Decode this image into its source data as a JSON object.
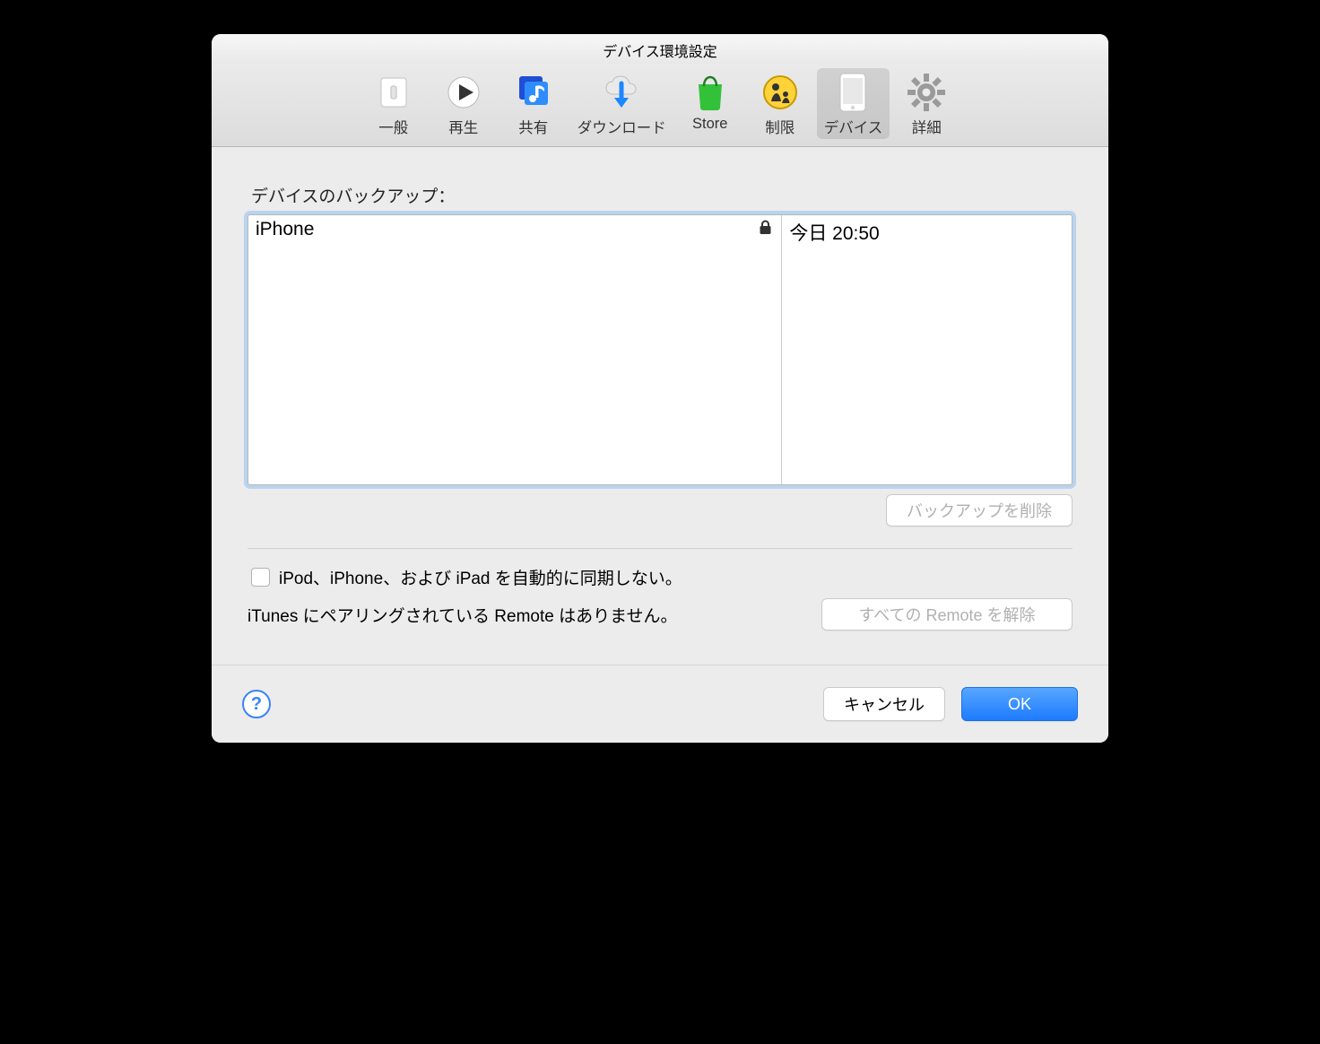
{
  "window": {
    "title": "デバイス環境設定"
  },
  "toolbar": {
    "items": [
      {
        "id": "general",
        "label": "一般"
      },
      {
        "id": "playback",
        "label": "再生"
      },
      {
        "id": "sharing",
        "label": "共有"
      },
      {
        "id": "downloads",
        "label": "ダウンロード"
      },
      {
        "id": "store",
        "label": "Store"
      },
      {
        "id": "parental",
        "label": "制限"
      },
      {
        "id": "devices",
        "label": "デバイス",
        "selected": true
      },
      {
        "id": "advanced",
        "label": "詳細"
      }
    ]
  },
  "backups": {
    "heading": "デバイスのバックアップ：",
    "rows": [
      {
        "name": "iPhone",
        "locked": true,
        "date": "今日 20:50"
      }
    ],
    "delete_label": "バックアップを削除",
    "delete_enabled": false
  },
  "options": {
    "no_autosync_label": "iPod、iPhone、および iPad を自動的に同期しない。",
    "no_autosync_checked": false,
    "pairing_status": "iTunes にペアリングされている Remote はありません。",
    "forget_remotes_label": "すべての Remote を解除",
    "forget_remotes_enabled": false
  },
  "footer": {
    "help": "?",
    "cancel": "キャンセル",
    "ok": "OK"
  }
}
